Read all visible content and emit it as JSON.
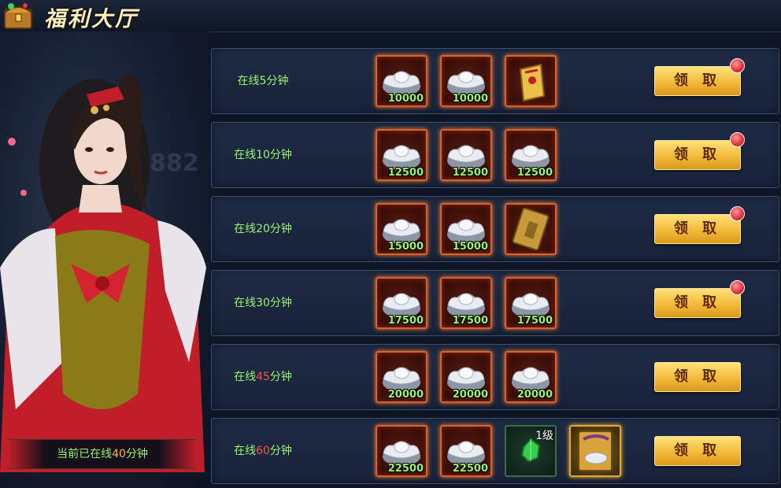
{
  "header": {
    "title": "福利大厅"
  },
  "status": {
    "prefix": "当前已在线",
    "minutes": "40",
    "suffix": "分钟"
  },
  "claim_label": "领 取",
  "rows": [
    {
      "pre": "在线",
      "num": "5",
      "post": "分钟",
      "num_red": false,
      "dot": true,
      "rewards": [
        {
          "icon": "silver-ingot-icon",
          "count": "10000"
        },
        {
          "icon": "silver-ingot-icon",
          "count": "10000"
        },
        {
          "icon": "red-envelope-scroll-icon",
          "count": ""
        }
      ]
    },
    {
      "pre": "在线",
      "num": "10",
      "post": "分钟",
      "num_red": false,
      "dot": true,
      "rewards": [
        {
          "icon": "silver-ingot-icon",
          "count": "12500"
        },
        {
          "icon": "silver-ingot-icon",
          "count": "12500"
        },
        {
          "icon": "silver-ingot-icon",
          "count": "12500"
        }
      ]
    },
    {
      "pre": "在线",
      "num": "20",
      "post": "分钟",
      "num_red": false,
      "dot": true,
      "rewards": [
        {
          "icon": "silver-ingot-icon",
          "count": "15000"
        },
        {
          "icon": "silver-ingot-icon",
          "count": "15000"
        },
        {
          "icon": "gold-card-icon",
          "count": ""
        }
      ]
    },
    {
      "pre": "在线",
      "num": "30",
      "post": "分钟",
      "num_red": false,
      "dot": true,
      "rewards": [
        {
          "icon": "silver-ingot-icon",
          "count": "17500"
        },
        {
          "icon": "silver-ingot-icon",
          "count": "17500"
        },
        {
          "icon": "silver-ingot-icon",
          "count": "17500"
        }
      ]
    },
    {
      "pre": "在线",
      "num": "45",
      "post": "分钟",
      "num_red": true,
      "dot": false,
      "rewards": [
        {
          "icon": "silver-ingot-icon",
          "count": "20000"
        },
        {
          "icon": "silver-ingot-icon",
          "count": "20000"
        },
        {
          "icon": "silver-ingot-icon",
          "count": "20000"
        }
      ]
    },
    {
      "pre": "在线",
      "num": "60",
      "post": "分钟",
      "num_red": true,
      "dot": false,
      "rewards": [
        {
          "icon": "silver-ingot-icon",
          "count": "22500"
        },
        {
          "icon": "silver-ingot-icon",
          "count": "22500"
        },
        {
          "icon": "green-gem-icon",
          "count": "",
          "level": "1级"
        },
        {
          "icon": "ingot-scroll-icon",
          "count": ""
        }
      ]
    }
  ]
}
